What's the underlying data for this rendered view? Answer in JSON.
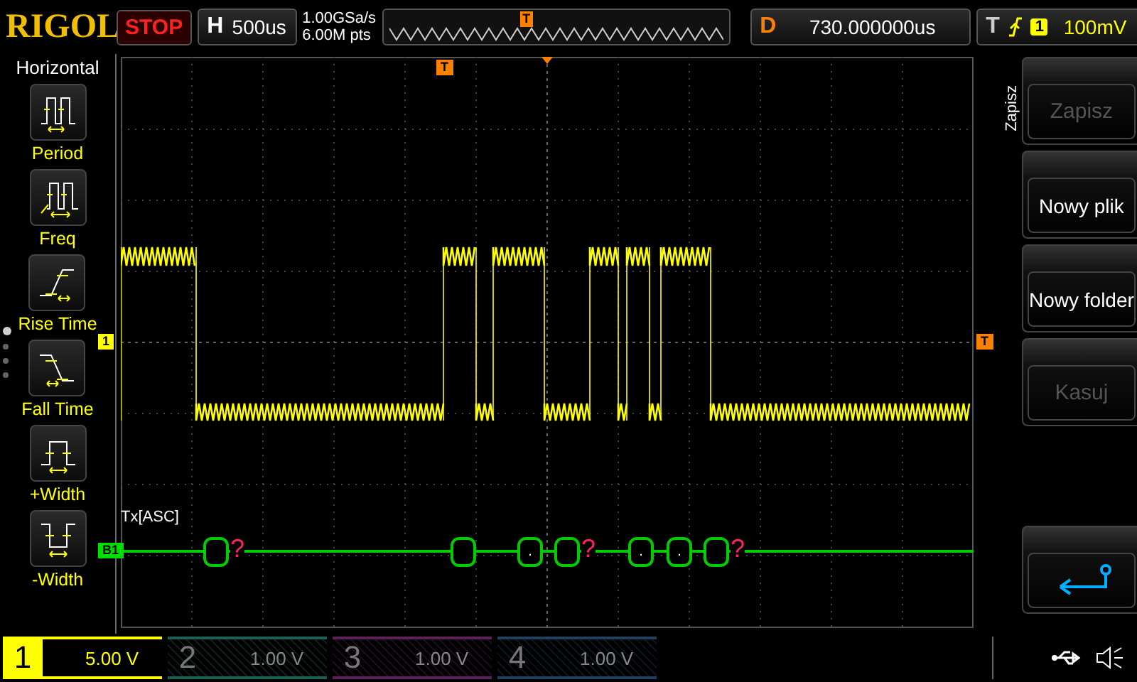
{
  "logo": "RIGOL",
  "run_state": "STOP",
  "timebase": {
    "label": "H",
    "value": "500us"
  },
  "acquisition": {
    "sample_rate": "1.00GSa/s",
    "memory_depth": "6.00M pts"
  },
  "memory_bar": {
    "marker": "T"
  },
  "delay": {
    "label": "D",
    "value": "730.000000us"
  },
  "trigger": {
    "label": "T",
    "source": "1",
    "level": "100mV"
  },
  "menu": {
    "title": "Horizontal",
    "pages": [
      {
        "selected": true
      },
      {
        "selected": false
      },
      {
        "selected": false
      },
      {
        "selected": false
      }
    ],
    "items": [
      {
        "kind": "period",
        "label": "Period"
      },
      {
        "kind": "freq",
        "label": "Freq"
      },
      {
        "kind": "rise",
        "label": "Rise Time"
      },
      {
        "kind": "fall",
        "label": "Fall Time"
      },
      {
        "kind": "pwidth",
        "label": "+Width"
      },
      {
        "kind": "nwidth",
        "label": "-Width"
      }
    ]
  },
  "display": {
    "trigger_position_marker": "T",
    "channel_marker": "1",
    "trigger_level_marker": "T",
    "bus_marker": "B1",
    "bus_label": "Tx[ASC]",
    "packets": [
      {
        "kind": "frame",
        "error_mark": "?"
      },
      {
        "kind": "frame"
      },
      {
        "kind": "frame",
        "text": "."
      },
      {
        "kind": "frame",
        "error_mark": "?"
      },
      {
        "kind": "frame",
        "text": "."
      },
      {
        "kind": "frame",
        "text": "."
      },
      {
        "kind": "frame",
        "error_mark": "?"
      }
    ]
  },
  "side_menu": {
    "title": "Zapisz",
    "buttons": [
      {
        "kind": "text",
        "label": "Zapisz",
        "disabled": true
      },
      {
        "kind": "text",
        "label": "Nowy plik",
        "disabled": false
      },
      {
        "kind": "text",
        "label": "Nowy folder",
        "disabled": false
      },
      {
        "kind": "text",
        "label": "Kasuj",
        "disabled": true
      },
      {
        "kind": "gap"
      },
      {
        "kind": "back"
      }
    ]
  },
  "channels": [
    {
      "number": "1",
      "scale": "5.00 V",
      "active": true,
      "color": "#ffff00"
    },
    {
      "number": "2",
      "scale": "1.00 V",
      "active": false,
      "color": "#1e5f55"
    },
    {
      "number": "3",
      "scale": "1.00 V",
      "active": false,
      "color": "#5c2258"
    },
    {
      "number": "4",
      "scale": "1.00 V",
      "active": false,
      "color": "#22405e"
    }
  ]
}
